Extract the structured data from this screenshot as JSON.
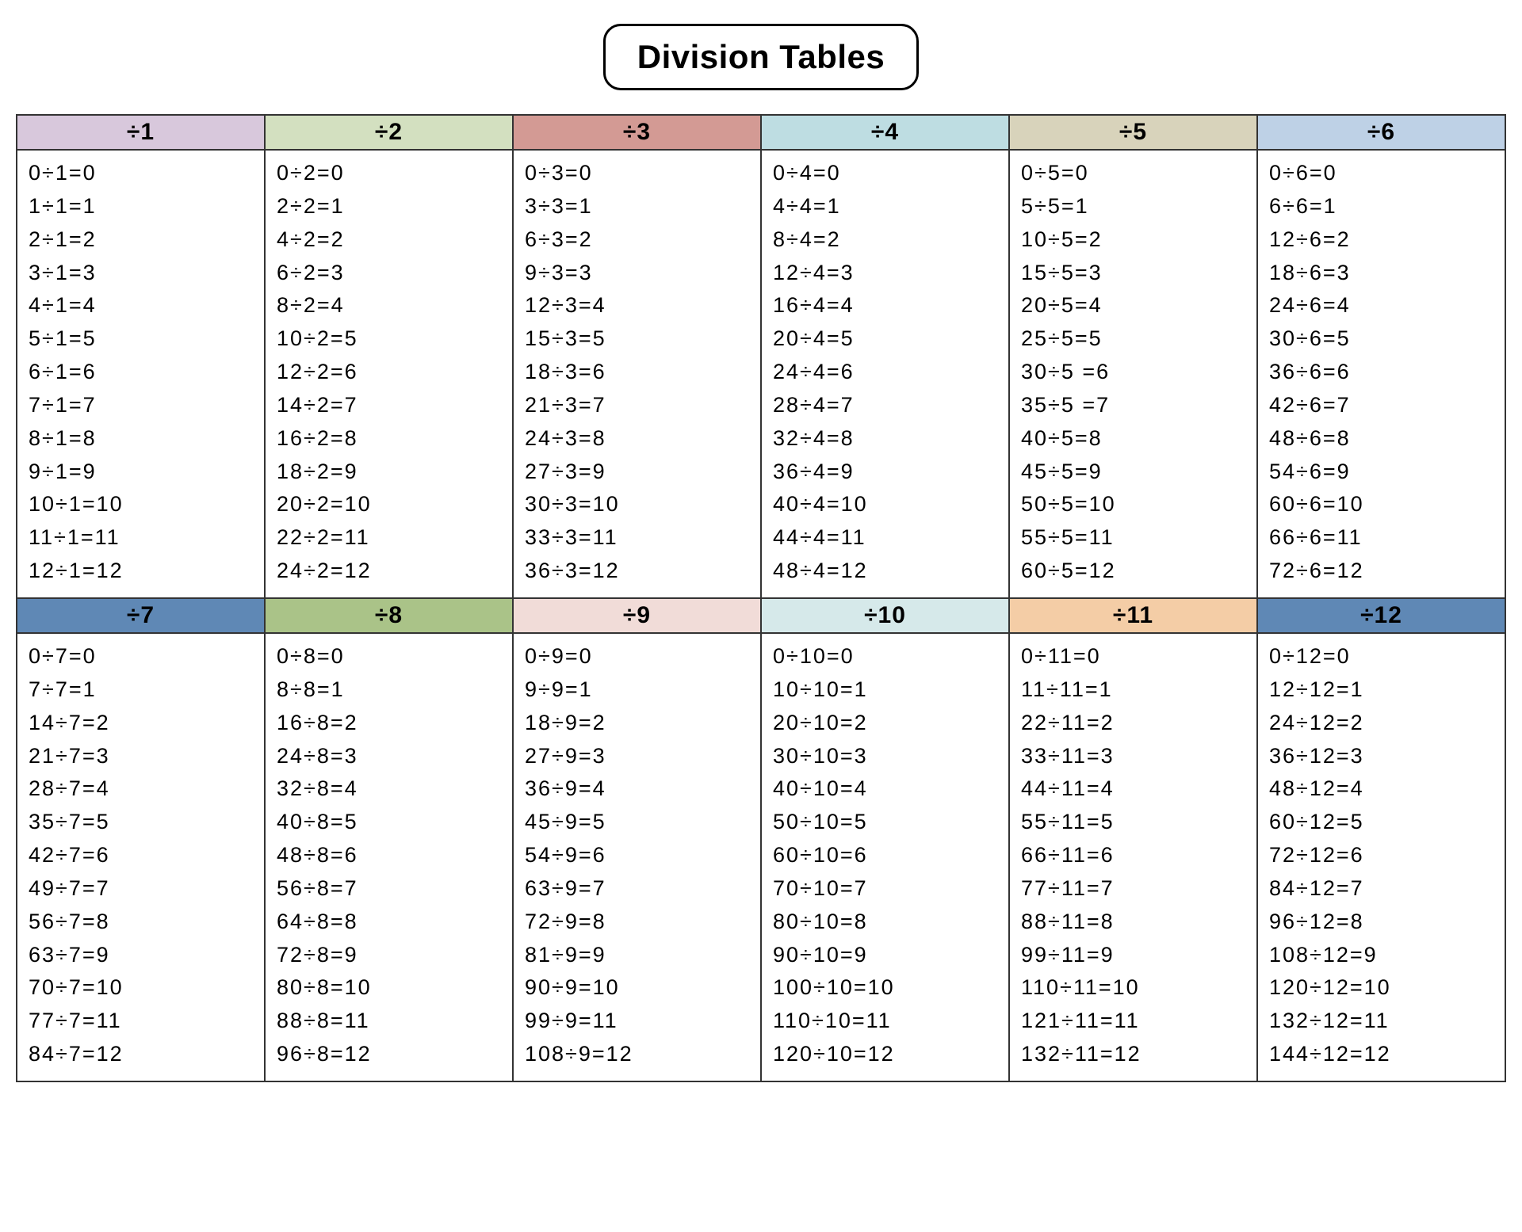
{
  "title": "Division Tables",
  "colors": {
    "d1": "#d8c8dc",
    "d2": "#d3e0c0",
    "d3": "#d39a94",
    "d4": "#bedde2",
    "d5": "#d8d3bb",
    "d6": "#bed1e6",
    "d7": "#5f88b5",
    "d8": "#aac388",
    "d9": "#f1dcd8",
    "d10": "#d6e9ea",
    "d11": "#f4cda6",
    "d12": "#5f88b5"
  },
  "chart_data": {
    "type": "table",
    "description": "Division tables ÷1 through ÷12, each listing n÷d = q for q = 0..12",
    "tables": [
      {
        "divisor": 1,
        "header": "÷1",
        "rows": [
          "0÷1=0",
          "1÷1=1",
          "2÷1=2",
          "3÷1=3",
          "4÷1=4",
          "5÷1=5",
          "6÷1=6",
          "7÷1=7",
          "8÷1=8",
          "9÷1=9",
          "10÷1=10",
          "11÷1=11",
          "12÷1=12"
        ]
      },
      {
        "divisor": 2,
        "header": "÷2",
        "rows": [
          "0÷2=0",
          "2÷2=1",
          "4÷2=2",
          "6÷2=3",
          "8÷2=4",
          "10÷2=5",
          "12÷2=6",
          "14÷2=7",
          "16÷2=8",
          "18÷2=9",
          "20÷2=10",
          "22÷2=11",
          "24÷2=12"
        ]
      },
      {
        "divisor": 3,
        "header": "÷3",
        "rows": [
          "0÷3=0",
          "3÷3=1",
          "6÷3=2",
          "9÷3=3",
          "12÷3=4",
          "15÷3=5",
          "18÷3=6",
          "21÷3=7",
          "24÷3=8",
          "27÷3=9",
          "30÷3=10",
          "33÷3=11",
          "36÷3=12"
        ]
      },
      {
        "divisor": 4,
        "header": "÷4",
        "rows": [
          "0÷4=0",
          "4÷4=1",
          "8÷4=2",
          "12÷4=3",
          "16÷4=4",
          "20÷4=5",
          "24÷4=6",
          "28÷4=7",
          "32÷4=8",
          "36÷4=9",
          "40÷4=10",
          "44÷4=11",
          "48÷4=12"
        ]
      },
      {
        "divisor": 5,
        "header": "÷5",
        "rows": [
          "0÷5=0",
          "5÷5=1",
          "10÷5=2",
          "15÷5=3",
          "20÷5=4",
          "25÷5=5",
          "30÷5 =6",
          "35÷5 =7",
          "40÷5=8",
          "45÷5=9",
          "50÷5=10",
          "55÷5=11",
          "60÷5=12"
        ]
      },
      {
        "divisor": 6,
        "header": "÷6",
        "rows": [
          "0÷6=0",
          "6÷6=1",
          "12÷6=2",
          "18÷6=3",
          "24÷6=4",
          "30÷6=5",
          "36÷6=6",
          "42÷6=7",
          "48÷6=8",
          "54÷6=9",
          "60÷6=10",
          "66÷6=11",
          "72÷6=12"
        ]
      },
      {
        "divisor": 7,
        "header": "÷7",
        "rows": [
          "0÷7=0",
          "7÷7=1",
          "14÷7=2",
          "21÷7=3",
          "28÷7=4",
          "35÷7=5",
          "42÷7=6",
          "49÷7=7",
          "56÷7=8",
          "63÷7=9",
          "70÷7=10",
          "77÷7=11",
          "84÷7=12"
        ]
      },
      {
        "divisor": 8,
        "header": "÷8",
        "rows": [
          "0÷8=0",
          "8÷8=1",
          "16÷8=2",
          "24÷8=3",
          "32÷8=4",
          "40÷8=5",
          "48÷8=6",
          "56÷8=7",
          "64÷8=8",
          "72÷8=9",
          "80÷8=10",
          "88÷8=11",
          "96÷8=12"
        ]
      },
      {
        "divisor": 9,
        "header": "÷9",
        "rows": [
          "0÷9=0",
          "9÷9=1",
          "18÷9=2",
          "27÷9=3",
          "36÷9=4",
          "45÷9=5",
          "54÷9=6",
          "63÷9=7",
          "72÷9=8",
          "81÷9=9",
          "90÷9=10",
          "99÷9=11",
          "108÷9=12"
        ]
      },
      {
        "divisor": 10,
        "header": "÷10",
        "rows": [
          "0÷10=0",
          "10÷10=1",
          "20÷10=2",
          "30÷10=3",
          "40÷10=4",
          "50÷10=5",
          "60÷10=6",
          "70÷10=7",
          "80÷10=8",
          "90÷10=9",
          "100÷10=10",
          "110÷10=11",
          "120÷10=12"
        ]
      },
      {
        "divisor": 11,
        "header": "÷11",
        "rows": [
          "0÷11=0",
          "11÷11=1",
          "22÷11=2",
          "33÷11=3",
          "44÷11=4",
          "55÷11=5",
          "66÷11=6",
          "77÷11=7",
          "88÷11=8",
          "99÷11=9",
          "110÷11=10",
          "121÷11=11",
          "132÷11=12"
        ]
      },
      {
        "divisor": 12,
        "header": "÷12",
        "rows": [
          "0÷12=0",
          "12÷12=1",
          "24÷12=2",
          "36÷12=3",
          "48÷12=4",
          "60÷12=5",
          "72÷12=6",
          "84÷12=7",
          "96÷12=8",
          "108÷12=9",
          "120÷12=10",
          "132÷12=11",
          "144÷12=12"
        ]
      }
    ]
  }
}
